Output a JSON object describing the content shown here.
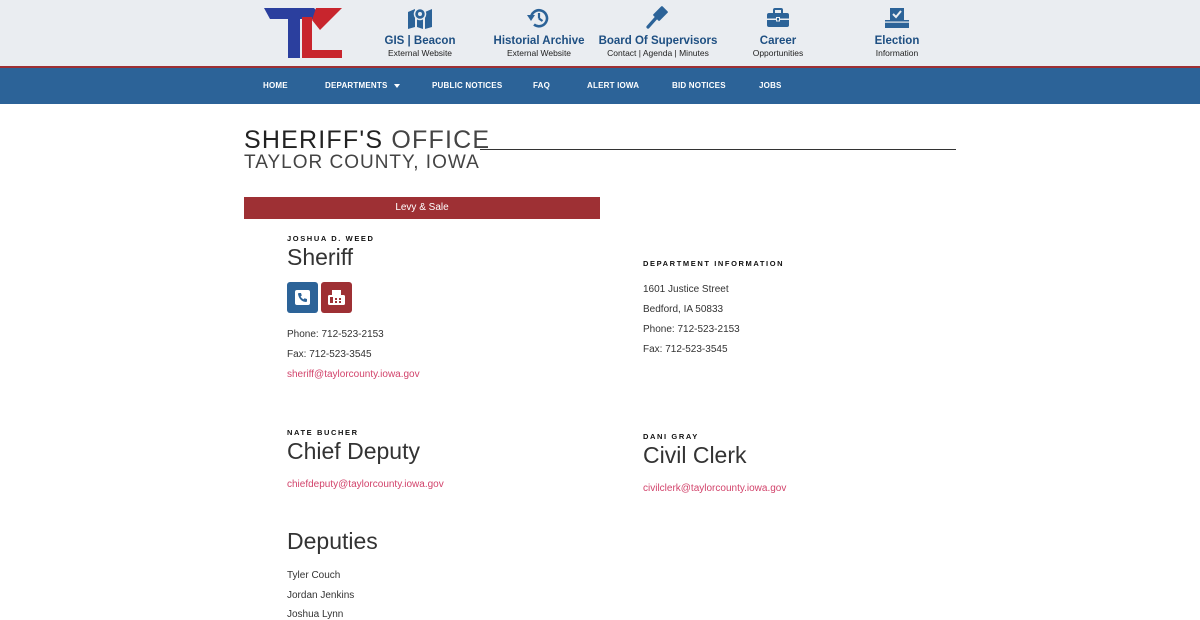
{
  "colors": {
    "brand_blue": "#2c6398",
    "brand_red": "#9e3034",
    "link_pink": "#d2436b",
    "header_bg": "#eaedf1"
  },
  "header": {
    "logo_icon": "taylor-county-logo-icon",
    "quick_links": [
      {
        "title": "GIS | Beacon",
        "subtitle": "External Website",
        "icon": "map-marker-icon"
      },
      {
        "title": "Historial Archive",
        "subtitle": "External Website",
        "icon": "history-icon"
      },
      {
        "title": "Board Of Supervisors",
        "subtitle": "Contact | Agenda | Minutes",
        "icon": "gavel-icon"
      },
      {
        "title": "Career",
        "subtitle": "Opportunities",
        "icon": "briefcase-icon"
      },
      {
        "title": "Election",
        "subtitle": "Information",
        "icon": "ballot-box-icon"
      }
    ]
  },
  "nav": {
    "items": [
      {
        "label": "HOME"
      },
      {
        "label": "DEPARTMENTS"
      },
      {
        "label": "PUBLIC NOTICES"
      },
      {
        "label": "FAQ"
      },
      {
        "label": "ALERT IOWA"
      },
      {
        "label": "BID NOTICES"
      },
      {
        "label": "JOBS"
      }
    ]
  },
  "page": {
    "title_strong": "SHERIFF'S",
    "title_light": "OFFICE",
    "subtitle": "TAYLOR COUNTY, IOWA",
    "levy_button": "Levy & Sale"
  },
  "sheriff": {
    "name": "JOSHUA D. WEED",
    "role": "Sheriff",
    "phone": "Phone: 712-523-2153",
    "fax": "Fax: 712-523-3545",
    "email": "sheriff@taylorcounty.iowa.gov"
  },
  "department_info": {
    "heading": "DEPARTMENT INFORMATION",
    "street": "1601 Justice Street",
    "city": "Bedford, IA 50833",
    "phone": "Phone: 712-523-2153",
    "fax": "Fax: 712-523-3545"
  },
  "chief_deputy": {
    "name": "NATE BUCHER",
    "role": "Chief Deputy",
    "email": "chiefdeputy@taylorcounty.iowa.gov"
  },
  "civil_clerk": {
    "name": "DANI GRAY",
    "role": "Civil Clerk",
    "email": "civilclerk@taylorcounty.iowa.gov"
  },
  "deputies": {
    "heading": "Deputies",
    "names": [
      "Tyler Couch",
      "Jordan Jenkins",
      "Joshua Lynn"
    ]
  }
}
